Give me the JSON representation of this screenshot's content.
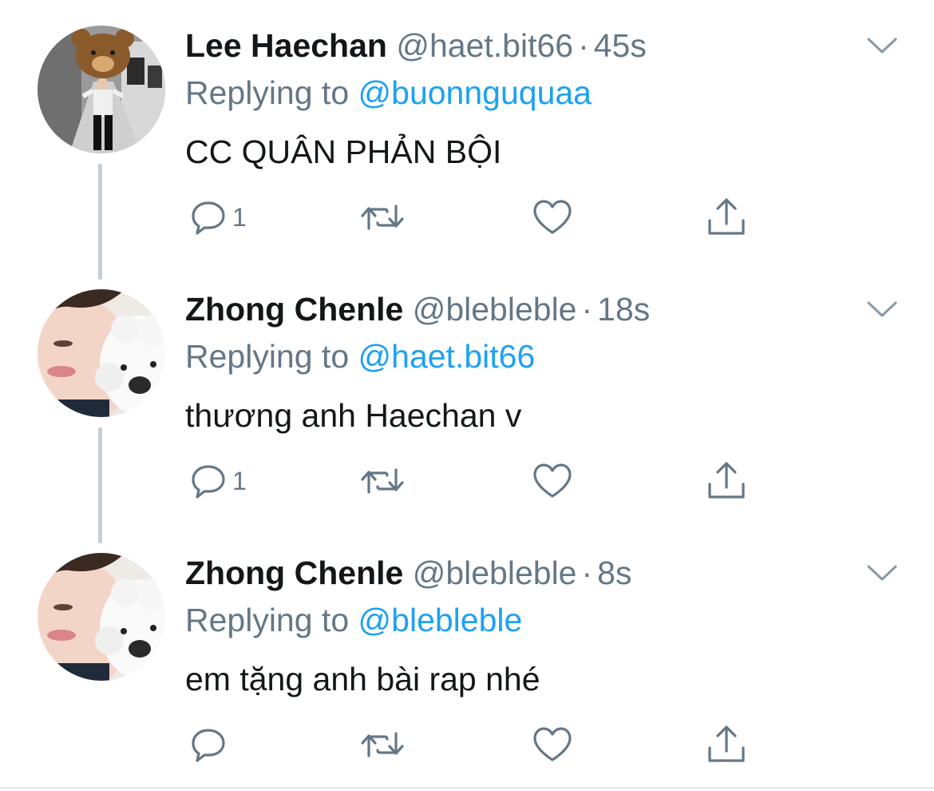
{
  "tweets": [
    {
      "name": "Lee Haechan",
      "handle": "@haet.bit66",
      "time": "45s",
      "replying_prefix": "Replying to",
      "reply_to": "@buonnguquaa",
      "text": "CC QUÂN PHẢN BỘI",
      "reply_count": "1",
      "avatar": "teddy-bear-avatar"
    },
    {
      "name": "Zhong Chenle",
      "handle": "@blebleble",
      "time": "18s",
      "replying_prefix": "Replying to",
      "reply_to": "@haet.bit66",
      "text": "thương anh Haechan v",
      "reply_count": "1",
      "avatar": "person-with-dog-avatar"
    },
    {
      "name": "Zhong Chenle",
      "handle": "@blebleble",
      "time": "8s",
      "replying_prefix": "Replying to",
      "reply_to": "@blebleble",
      "text": "em tặng anh bài rap nhé",
      "reply_count": "",
      "avatar": "person-with-dog-avatar"
    }
  ],
  "separator": "·",
  "icons": {
    "reply": "reply-icon",
    "retweet": "retweet-icon",
    "like": "heart-icon",
    "share": "share-icon",
    "more": "chevron-down-icon"
  },
  "colors": {
    "name": "#14171a",
    "secondary": "#657786",
    "link": "#1da1f2",
    "thread_line": "#c4cfd6"
  }
}
